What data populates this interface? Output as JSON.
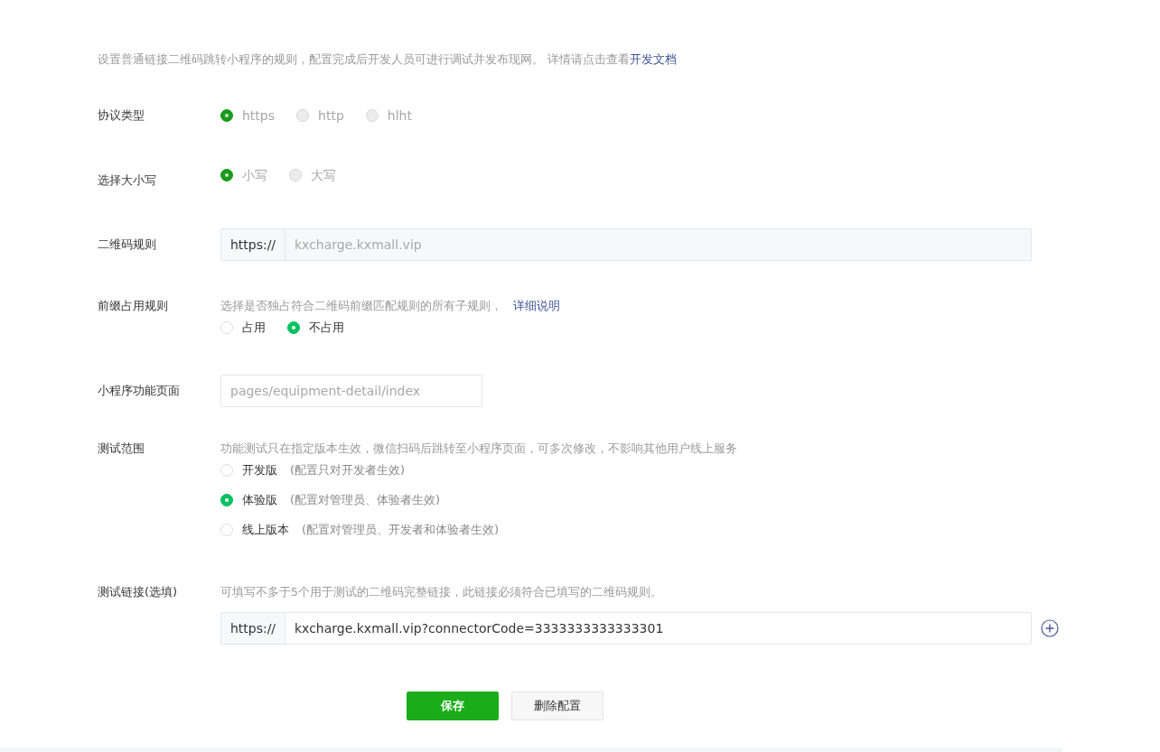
{
  "intro": {
    "text": "设置普通链接二维码跳转小程序的规则，配置完成后开发人员可进行调试并发布现网。 详情请点击查看",
    "link": "开发文档"
  },
  "rows": [
    {
      "kind": "radio",
      "label": "协议类型",
      "disabled": true,
      "options": [
        {
          "label": "https",
          "selected": true
        },
        {
          "label": "http",
          "selected": false
        },
        {
          "label": "hlht",
          "selected": false
        }
      ]
    },
    {
      "kind": "radio",
      "label": "选择大小写",
      "disabled": true,
      "options": [
        {
          "label": "小写",
          "selected": true
        },
        {
          "label": "大写",
          "selected": false
        }
      ]
    },
    {
      "kind": "prefixed",
      "label": "二维码规则",
      "prefix": "https://",
      "value": "kxcharge.kxmall.vip",
      "disabled": true
    },
    {
      "kind": "radio",
      "label": "前缀占用规则",
      "hint": "选择是否独占符合二维码前缀匹配规则的所有子规则，",
      "hint_link": "详细说明",
      "disabled": false,
      "options": [
        {
          "label": "占用",
          "selected": false
        },
        {
          "label": "不占用",
          "selected": true
        }
      ]
    },
    {
      "kind": "text",
      "label": "小程序功能页面",
      "placeholder": "pages/equipment-detail/index"
    },
    {
      "kind": "radio",
      "label": "测试范围",
      "hint": "功能测试只在指定版本生效，微信扫码后跳转至小程序页面，可多次修改，不影响其他用户线上服务",
      "disabled": false,
      "options": [
        {
          "label": "开发版",
          "note": "(配置只对开发者生效)",
          "selected": false
        },
        {
          "label": "体验版",
          "note": "(配置对管理员、体验者生效)",
          "selected": true
        },
        {
          "label": "线上版本",
          "note": "(配置对管理员、开发者和体验者生效)",
          "selected": false
        }
      ]
    },
    {
      "kind": "prefixed",
      "label": "测试链接(选填)",
      "hint": "可填写不多于5个用于测试的二维码完整链接，此链接必须符合已填写的二维码规则。",
      "prefix": "https://",
      "value": "kxcharge.kxmall.vip?connectorCode=3333333333333301",
      "disabled": false,
      "addable": true
    }
  ],
  "buttons": [
    {
      "label": "保存",
      "kind": "primary"
    },
    {
      "label": "删除配置",
      "kind": "default"
    }
  ]
}
